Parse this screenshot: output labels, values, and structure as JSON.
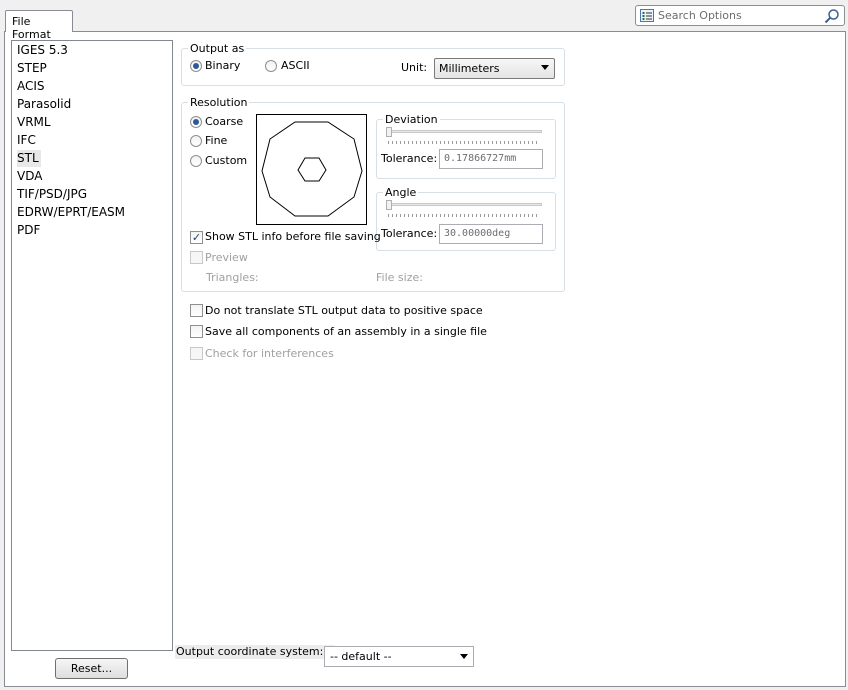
{
  "tab": {
    "label": "File Format"
  },
  "search": {
    "placeholder": "Search Options"
  },
  "formats": {
    "items": [
      "IGES 5.3",
      "STEP",
      "ACIS",
      "Parasolid",
      "VRML",
      "IFC",
      "STL",
      "VDA",
      "TIF/PSD/JPG",
      "EDRW/EPRT/EASM",
      "PDF"
    ],
    "selected": "STL"
  },
  "reset": {
    "label": "Reset..."
  },
  "output_as": {
    "legend": "Output as",
    "binary": "Binary",
    "ascii": "ASCII",
    "selected": "Binary",
    "unit_label": "Unit:",
    "unit_value": "Millimeters"
  },
  "resolution": {
    "legend": "Resolution",
    "coarse": "Coarse",
    "fine": "Fine",
    "custom": "Custom",
    "selected": "Coarse",
    "deviation": {
      "legend": "Deviation",
      "tolerance_label": "Tolerance:",
      "tolerance_value": "0.17866727mm"
    },
    "angle": {
      "legend": "Angle",
      "tolerance_label": "Tolerance:",
      "tolerance_value": "30.00000deg"
    },
    "show_stl_info": {
      "label": "Show STL info before file saving",
      "checked": true
    },
    "preview": {
      "label": "Preview",
      "checked": false
    },
    "triangles_label": "Triangles:",
    "file_size_label": "File size:"
  },
  "options": {
    "no_translate": {
      "label": "Do not translate STL output data to positive space",
      "checked": false
    },
    "save_single": {
      "label": "Save all components of an assembly in a single file",
      "checked": false
    },
    "check_interferences": {
      "label": "Check for interferences",
      "checked": false
    }
  },
  "coord": {
    "label": "Output coordinate system:",
    "value": "-- default --"
  },
  "colors": {
    "accent": "#2a5a9c",
    "panel_border": "#898c95",
    "group_border": "#d5dfe5"
  }
}
